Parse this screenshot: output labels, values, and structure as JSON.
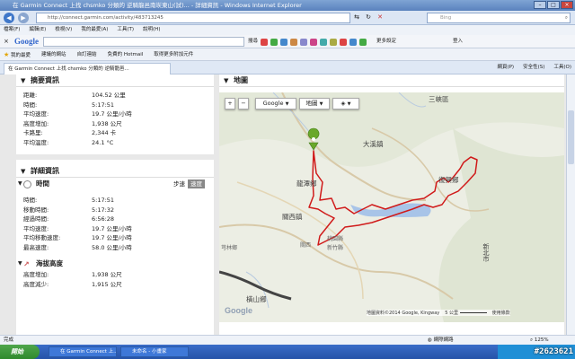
{
  "window": {
    "title": "在 Garmin Connect 上找 chsmko 分類的 逆騎龍邑南崁東山(試)... - 詳細資訊 - Windows Internet Explorer"
  },
  "browser": {
    "url": "http://connect.garmin.com/activity/483713245",
    "search_placeholder": "Bing",
    "menu": [
      "檔案(F)",
      "編輯(E)",
      "檢視(V)",
      "我的最愛(A)",
      "工具(T)",
      "說明(H)"
    ],
    "google_toolbar": {
      "search_btn": "搜尋",
      "more": "更多設定",
      "user": "登入"
    },
    "favorites": [
      "我的最愛",
      "建議的網站",
      "自訂連結",
      "免費的 Hotmail",
      "取得更多附加元件"
    ],
    "tab_label": "在 Garmin Connect 上找 chsmko 分類的 逆騎龍邑...",
    "cmd": [
      "網頁(P)",
      "安全性(S)",
      "工具(O)"
    ]
  },
  "summary": {
    "title": "摘要資訊",
    "rows": [
      {
        "label": "距離:",
        "value": "104.52 公里"
      },
      {
        "label": "時間:",
        "value": "5:17:51"
      },
      {
        "label": "平均速度:",
        "value": "19.7 公里/小時"
      },
      {
        "label": "高度增加:",
        "value": "1,938 公尺"
      },
      {
        "label": "卡路里:",
        "value": "2,344 卡"
      },
      {
        "label": "平均溫度:",
        "value": "24.1 °C"
      }
    ]
  },
  "details": {
    "title": "詳細資訊",
    "timing": {
      "title": "時間",
      "toggle": [
        "步速",
        "速度"
      ],
      "rows": [
        {
          "label": "時間:",
          "value": "5:17:51"
        },
        {
          "label": "移動時間:",
          "value": "5:17:32"
        },
        {
          "label": "經過時間:",
          "value": "6:56:28"
        },
        {
          "label": "平均速度:",
          "value": "19.7 公里/小時"
        },
        {
          "label": "平均移動速度:",
          "value": "19.7 公里/小時"
        },
        {
          "label": "最高速度:",
          "value": "58.0 公里/小時"
        }
      ]
    },
    "elevation": {
      "title": "海拔高度",
      "rows": [
        {
          "label": "高度增加:",
          "value": "1,938 公尺"
        },
        {
          "label": "高度減少:",
          "value": "1,915 公尺"
        }
      ]
    }
  },
  "map": {
    "title": "地圖",
    "type_label": "Google",
    "view_label": "地圖",
    "places": [
      "三峽區",
      "大溪鎮",
      "龍潭鄉",
      "關西鎮",
      "橫山鄉",
      "復興鄉",
      "新竹縣",
      "桃園縣",
      "芎林鄉",
      "新北市",
      "關西"
    ],
    "attribution": "地圖資料©2014 Google, Kingway",
    "scale": "5 公里",
    "report": "使用條款",
    "logo": "Google"
  },
  "status": {
    "left": "完成",
    "zone": "網際網路",
    "zoom": "125%"
  },
  "taskbar": {
    "start": "開始",
    "tasks": [
      "在 Garmin Connect 上...",
      "未命名 - 小畫家"
    ],
    "time": ""
  },
  "watermark": "#2623621"
}
